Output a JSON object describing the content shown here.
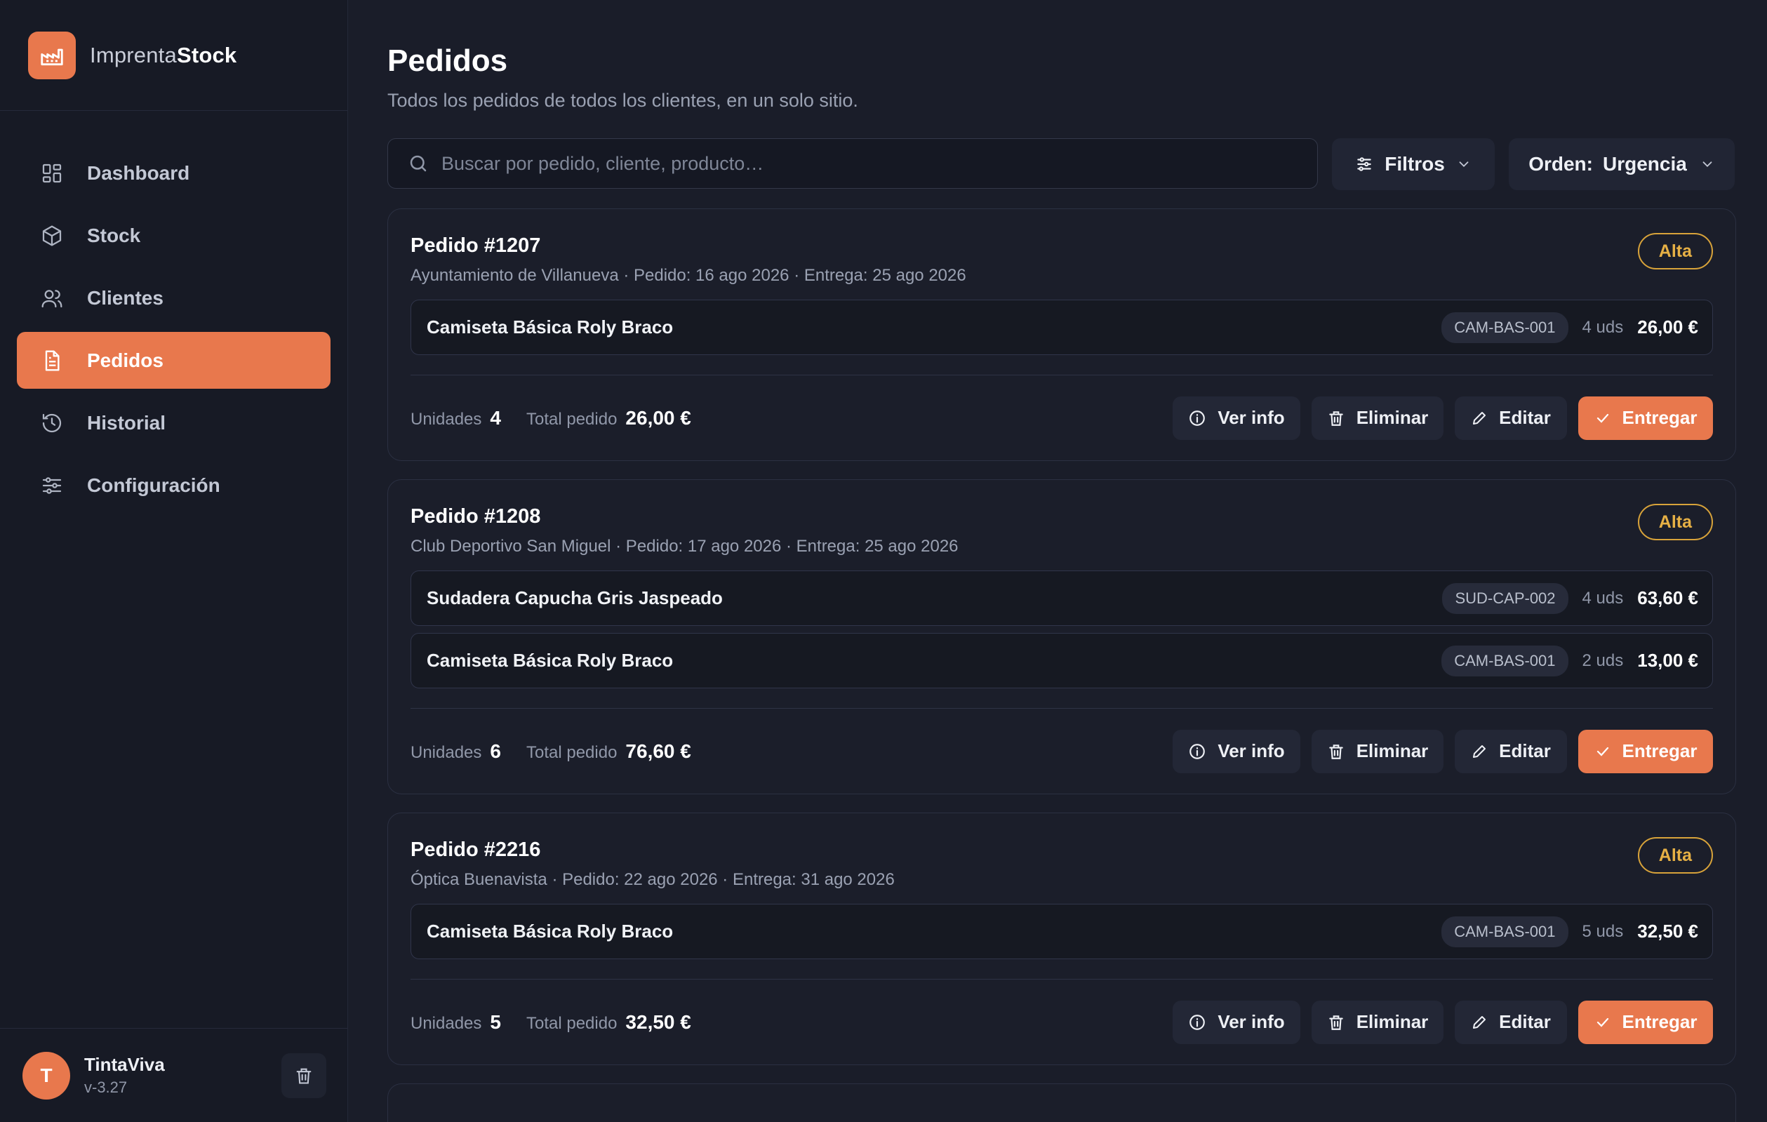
{
  "brand": {
    "name_light": "Imprenta",
    "name_bold": "Stock"
  },
  "nav": [
    {
      "label": "Dashboard",
      "icon": "dashboard-icon",
      "active": false
    },
    {
      "label": "Stock",
      "icon": "box-icon",
      "active": false
    },
    {
      "label": "Clientes",
      "icon": "users-icon",
      "active": false
    },
    {
      "label": "Pedidos",
      "icon": "document-icon",
      "active": true
    },
    {
      "label": "Historial",
      "icon": "history-icon",
      "active": false
    },
    {
      "label": "Configuración",
      "icon": "sliders-icon",
      "active": false
    }
  ],
  "user": {
    "initial": "T",
    "name": "TintaViva",
    "version": "v-3.27"
  },
  "page": {
    "title": "Pedidos",
    "subtitle": "Todos los pedidos de todos los clientes, en un solo sitio."
  },
  "toolbar": {
    "search_placeholder": "Buscar por pedido, cliente, producto…",
    "filters_label": "Filtros",
    "order_label": "Orden:",
    "order_value": "Urgencia"
  },
  "labels": {
    "units": "Unidades",
    "total": "Total pedido",
    "info": "Ver info",
    "delete": "Eliminar",
    "edit": "Editar",
    "deliver": "Entregar"
  },
  "orders": [
    {
      "title": "Pedido #1207",
      "meta": "Ayuntamiento de Villanueva · Pedido: 16 ago 2026 · Entrega: 25 ago 2026",
      "priority": "Alta",
      "lines": [
        {
          "name": "Camiseta Básica Roly Braco",
          "sku": "CAM-BAS-001",
          "qty": "4 uds",
          "price": "26,00 €"
        }
      ],
      "units": "4",
      "total": "26,00 €"
    },
    {
      "title": "Pedido #1208",
      "meta": "Club Deportivo San Miguel · Pedido: 17 ago 2026 · Entrega: 25 ago 2026",
      "priority": "Alta",
      "lines": [
        {
          "name": "Sudadera Capucha Gris Jaspeado",
          "sku": "SUD-CAP-002",
          "qty": "4 uds",
          "price": "63,60 €"
        },
        {
          "name": "Camiseta Básica Roly Braco",
          "sku": "CAM-BAS-001",
          "qty": "2 uds",
          "price": "13,00 €"
        }
      ],
      "units": "6",
      "total": "76,60 €"
    },
    {
      "title": "Pedido #2216",
      "meta": "Óptica Buenavista · Pedido: 22 ago 2026 · Entrega: 31 ago 2026",
      "priority": "Alta",
      "lines": [
        {
          "name": "Camiseta Básica Roly Braco",
          "sku": "CAM-BAS-001",
          "qty": "5 uds",
          "price": "32,50 €"
        }
      ],
      "units": "5",
      "total": "32,50 €"
    }
  ],
  "colors": {
    "accent": "#e8784d",
    "priority": "#d8a33a",
    "bg": "#1a1d29"
  }
}
